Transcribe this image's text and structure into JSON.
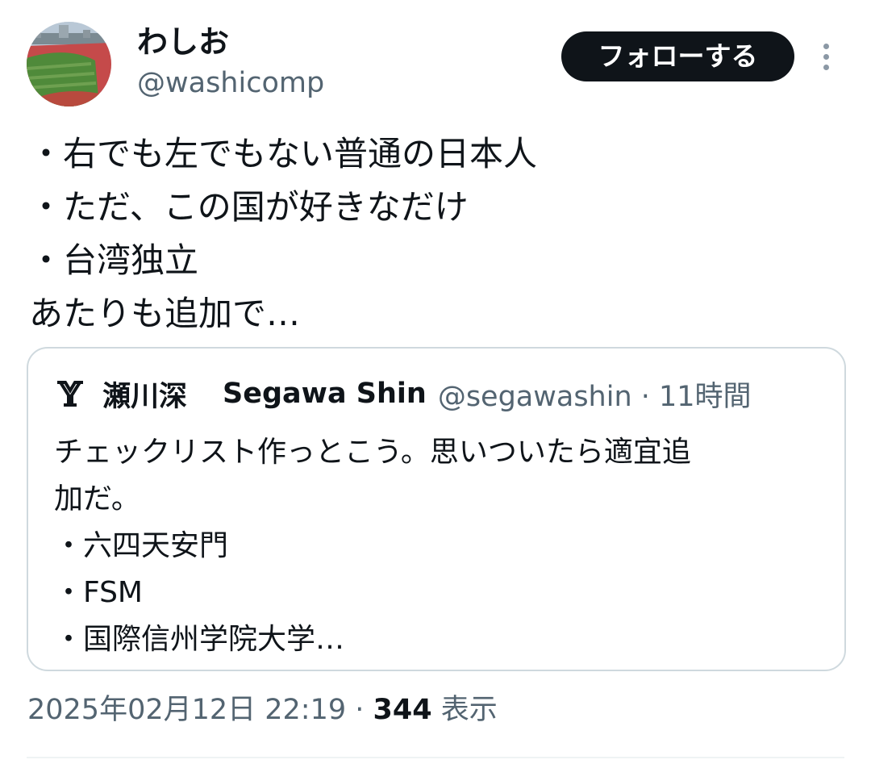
{
  "author": {
    "display_name": "わしお",
    "handle": "@washicomp",
    "avatar_icon": "stadium-photo-avatar"
  },
  "follow_label": "フォローする",
  "more_icon": "more-vertical-icon",
  "tweet": {
    "lines": [
      "・右でも左でもない普通の日本人",
      "・ただ、この国が好きなだけ",
      "・台湾独立",
      "あたりも追加で…"
    ]
  },
  "quote": {
    "logo_icon": "author-logo-icon",
    "name_jp": "瀬川深",
    "name_en": "Segawa Shin",
    "meta": "@segawashin · 11時間",
    "lines": [
      "チェックリスト作っとこう。思いついたら適宜追",
      "加だ。",
      "・六四天安門",
      "・FSM",
      "・国際信州学院大学…"
    ]
  },
  "timestamp": "2025年02月12日 22:19 · ",
  "views_count": "344",
  "views_label": " 表示",
  "colors": {
    "text_primary": "#0f1419",
    "text_secondary": "#536471",
    "button_bg": "#0f1419",
    "border": "#cfd9de"
  }
}
